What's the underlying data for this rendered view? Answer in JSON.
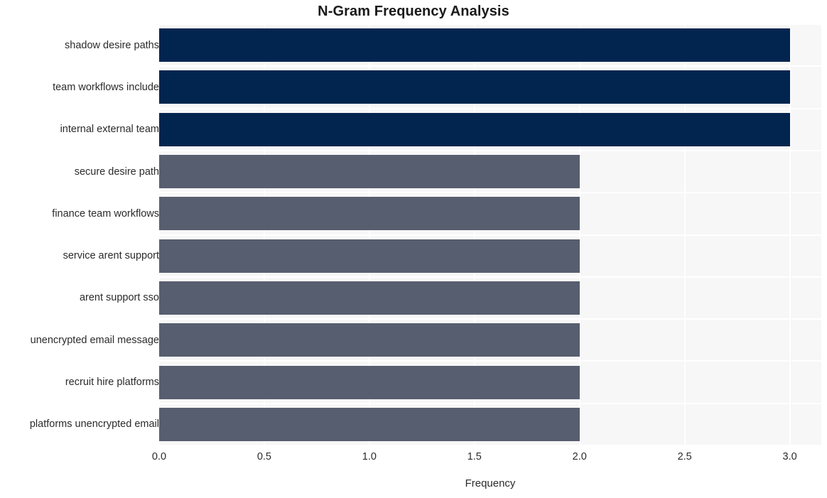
{
  "chart_data": {
    "type": "bar",
    "orientation": "horizontal",
    "title": "N-Gram Frequency Analysis",
    "xlabel": "Frequency",
    "ylabel": "",
    "xlim": [
      0.0,
      3.15
    ],
    "ylim": [
      0,
      10
    ],
    "grid": true,
    "legend": "none",
    "xticks": [
      "0.0",
      "0.5",
      "1.0",
      "1.5",
      "2.0",
      "2.5",
      "3.0"
    ],
    "xtick_values": [
      0.0,
      0.5,
      1.0,
      1.5,
      2.0,
      2.5,
      3.0
    ],
    "categories": [
      "shadow desire paths",
      "team workflows include",
      "internal external team",
      "secure desire path",
      "finance team workflows",
      "service arent support",
      "arent support sso",
      "unencrypted email message",
      "recruit hire platforms",
      "platforms unencrypted email"
    ],
    "values": [
      3,
      3,
      3,
      2,
      2,
      2,
      2,
      2,
      2,
      2
    ],
    "bar_colors": [
      "#02254f",
      "#02254f",
      "#02254f",
      "#575e6f",
      "#575e6f",
      "#575e6f",
      "#575e6f",
      "#575e6f",
      "#575e6f",
      "#575e6f"
    ]
  },
  "style": {
    "plot_background": "#f7f7f8",
    "figure_background": "#ffffff",
    "gridline_color": "#ffffff",
    "text_color": "#2b2b2b",
    "title_color": "#1a1a1a",
    "color_high": "#02254f",
    "color_low": "#575e6f"
  }
}
